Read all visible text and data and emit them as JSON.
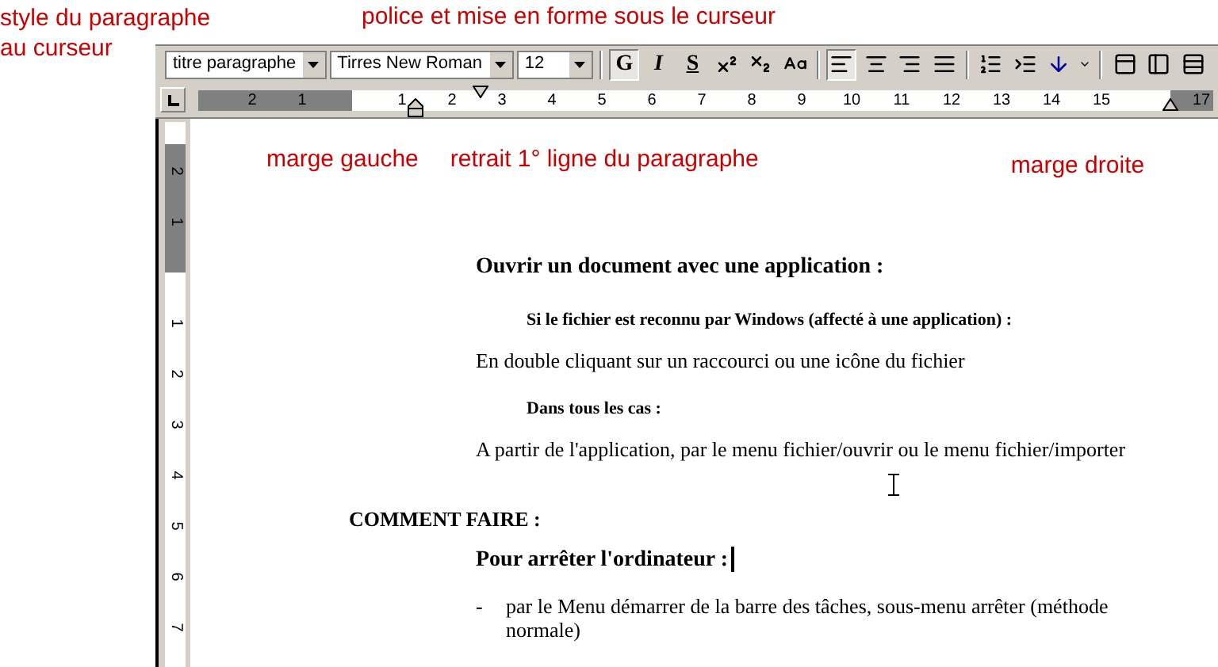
{
  "annotations": {
    "style_label": [
      "style du paragraphe",
      "au curseur"
    ],
    "font_label": "police et mise en forme sous le curseur",
    "left_margin_label": "marge gauche",
    "first_line_label": "retrait 1° ligne du paragraphe",
    "right_margin_label": "marge droite"
  },
  "toolbar": {
    "style_box": "titre paragraphe",
    "font_box": "Tirres New Roman",
    "size_box": "12",
    "groups": [
      [
        {
          "kind": "bold",
          "label": "G",
          "selected": true
        },
        {
          "kind": "italic",
          "label": "I",
          "selected": false
        },
        {
          "kind": "underline",
          "label": "S",
          "selected": false
        },
        {
          "kind": "superscript",
          "selected": false
        },
        {
          "kind": "subscript",
          "selected": false
        },
        {
          "kind": "case",
          "selected": false
        }
      ],
      [
        {
          "kind": "align-left",
          "selected": true
        },
        {
          "kind": "align-center",
          "selected": false
        },
        {
          "kind": "align-right",
          "selected": false
        },
        {
          "kind": "justify",
          "selected": false
        }
      ],
      [
        {
          "kind": "numbered-list",
          "selected": false
        },
        {
          "kind": "indent",
          "selected": false
        },
        {
          "kind": "arrow-down",
          "selected": false
        },
        {
          "kind": "more",
          "selected": false
        }
      ],
      [
        {
          "kind": "view-frame",
          "selected": false
        },
        {
          "kind": "view-page",
          "selected": false
        },
        {
          "kind": "view-list",
          "selected": false
        }
      ]
    ]
  },
  "ruler": {
    "ticks": [
      "2",
      "1",
      "1",
      "2",
      "3",
      "4",
      "5",
      "6",
      "7",
      "8",
      "9",
      "10",
      "11",
      "12",
      "13",
      "14",
      "15",
      "17"
    ]
  },
  "vertical_ruler": {
    "ticks": [
      "2",
      "1",
      "1",
      "2",
      "3",
      "4",
      "5",
      "6",
      "7"
    ]
  },
  "document": [
    {
      "kind": "heading",
      "text": "Ouvrir un document avec une application :"
    },
    {
      "kind": "subheading",
      "text": "Si le fichier est reconnu par Windows (affecté à une application) :"
    },
    {
      "kind": "body",
      "text": "En double cliquant sur un raccourci ou une icône du fichier"
    },
    {
      "kind": "subheading",
      "text": "Dans tous les cas :"
    },
    {
      "kind": "body",
      "text": "A partir de l'application, par le menu fichier/ouvrir ou le menu fichier/importer"
    },
    {
      "kind": "pointer"
    },
    {
      "kind": "section",
      "text": "COMMENT FAIRE :"
    },
    {
      "kind": "heading",
      "text": "Pour arrêter l'ordinateur :",
      "caret": true
    },
    {
      "kind": "bullet",
      "marker": "-",
      "text": "par le Menu démarrer de la barre des tâches, sous-menu arrêter (méthode normale)"
    }
  ]
}
